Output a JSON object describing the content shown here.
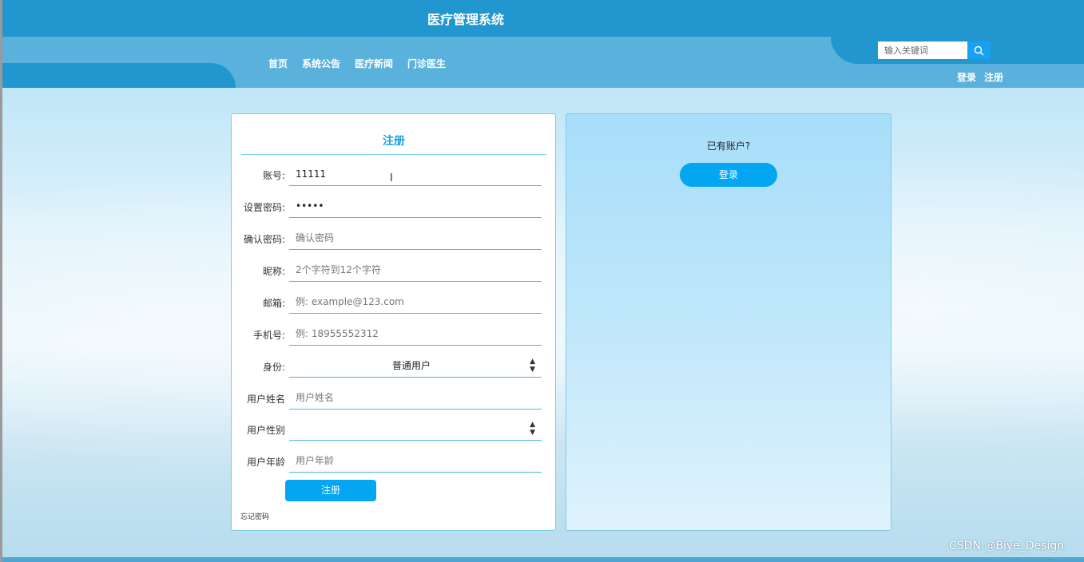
{
  "header": {
    "title": "医疗管理系统",
    "nav": [
      "首页",
      "系统公告",
      "医疗新闻",
      "门诊医生"
    ],
    "search_placeholder": "输入关键词",
    "auth": {
      "login": "登录",
      "register": "注册"
    }
  },
  "register_form": {
    "title": "注册",
    "fields": [
      {
        "label": "账号:",
        "value": "11111",
        "placeholder": ""
      },
      {
        "label": "设置密码:",
        "value": "•••••",
        "placeholder": ""
      },
      {
        "label": "确认密码:",
        "value": "",
        "placeholder": "确认密码"
      },
      {
        "label": "昵称:",
        "value": "",
        "placeholder": "2个字符到12个字符"
      },
      {
        "label": "邮箱:",
        "value": "",
        "placeholder": "例: example@123.com"
      },
      {
        "label": "手机号:",
        "value": "",
        "placeholder": "例: 18955552312"
      },
      {
        "label": "身份:",
        "selected": "普通用户"
      },
      {
        "label": "用户姓名",
        "value": "",
        "placeholder": "用户姓名"
      },
      {
        "label": "用户性别",
        "selected": ""
      },
      {
        "label": "用户年龄",
        "value": "",
        "placeholder": "用户年龄"
      }
    ],
    "submit_label": "注册",
    "forgot_label": "忘记密码"
  },
  "login_panel": {
    "prompt": "已有账户?",
    "login_label": "登录"
  },
  "watermark": "CSDN @Biye_Design",
  "colors": {
    "header": "#2196cf",
    "nav_band": "#5ab1dc",
    "accent": "#04a6f2",
    "title": "#1aa0e0"
  }
}
